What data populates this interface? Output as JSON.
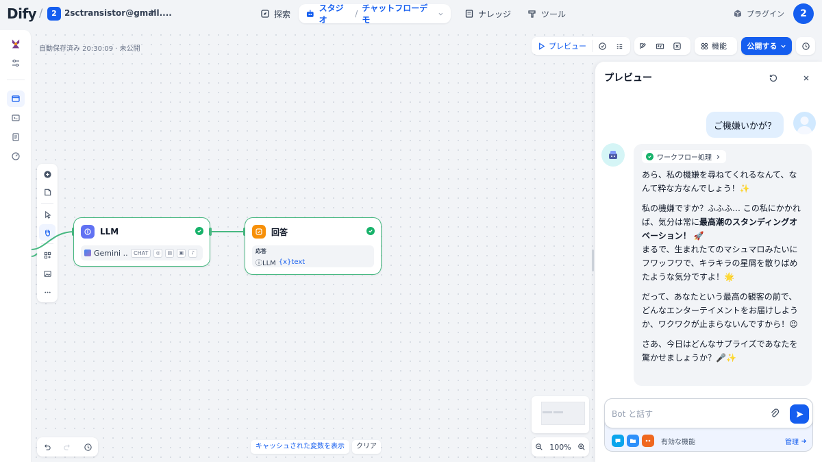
{
  "nav": {
    "logo": "Dify",
    "workspace_badge": "2",
    "workspace_name": "2sctransistor@gmail....",
    "explore": "探索",
    "studio": "スタジオ",
    "app_name": "チャットフローデモ",
    "knowledge": "ナレッジ",
    "tools": "ツール",
    "plugin": "プラグイン",
    "avatar": "2"
  },
  "canvas": {
    "autosave": "自動保存済み 20:30:09 · 未公開",
    "preview_label": "プレビュー",
    "feature_label": "機能",
    "publish_label": "公開する",
    "cache_label": "キャッシュされた変数を表示",
    "clear_label": "クリア",
    "zoom": "100%"
  },
  "nodes": {
    "llm": {
      "title": "LLM",
      "model": "Gemini ...",
      "mode": "CHAT"
    },
    "answer": {
      "title": "回答",
      "field_label": "応答",
      "var_source": "LLM",
      "var_name": "{x}text"
    }
  },
  "panel": {
    "title": "プレビュー",
    "user_message": "ご機嫌いかが？",
    "workflow_tag": "ワークフロー処理",
    "bot": {
      "p1": "あら、私の機嫌を尋ねてくれるなんて、なんて粋な方なんでしょう！✨",
      "p2_a": "私の機嫌ですか？ふふふ… この私にかかれば、気分は常に",
      "p2_bold": "最高潮のスタンディングオベーション！",
      "p2_b": " 🚀",
      "p2_c": "まるで、生まれたてのマシュマロみたいにフワッフワで、キラキラの星屑を散りばめたような気分ですよ！🌟",
      "p3": "だって、あなたという最高の観客の前で、どんなエンターテイメントをお届けしようか、ワクワクが止まらないんですから！😉",
      "p4": "さあ、今日はどんなサプライズであなたを驚かせましょうか？🎤✨"
    },
    "input_placeholder": "Bot と話す",
    "features_label": "有効な機能",
    "manage_label": "管理"
  },
  "colors": {
    "accent": "#155eef",
    "node_border": "#47b881",
    "llm_icon": "#6172f3",
    "answer_icon": "#f79009"
  }
}
